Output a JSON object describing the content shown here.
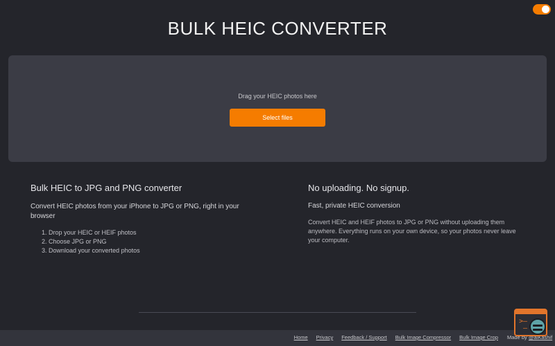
{
  "header": {
    "title": "BULK HEIC CONVERTER"
  },
  "theme_toggle": {
    "state": "on",
    "color": "#f57c00"
  },
  "dropzone": {
    "prompt": "Drag your HEIC photos here",
    "button_label": "Select files"
  },
  "left_column": {
    "heading": "Bulk HEIC to JPG and PNG converter",
    "subheading": "Convert HEIC photos from your iPhone to JPG or PNG, right in your browser",
    "steps": [
      "1. Drop your HEIC or HEIF photos",
      "2. Choose JPG or PNG",
      "3. Download your converted photos"
    ]
  },
  "right_column": {
    "heading": "No uploading. No signup.",
    "subheading": "Fast, private HEIC conversion",
    "description": "Convert HEIC and HEIF photos to JPG or PNG without uploading them anywhere. Everything runs on your own device, so your photos never leave your computer."
  },
  "footer": {
    "links": [
      "Home",
      "Privacy",
      "Feedback / Support",
      "Bulk Image Compressor",
      "Bulk Image Crop"
    ],
    "made_by_prefix": "Made by",
    "made_by_handle": "@alKashif"
  },
  "colors": {
    "accent": "#f57c00",
    "background": "#24252b",
    "panel": "#3b3c45"
  }
}
